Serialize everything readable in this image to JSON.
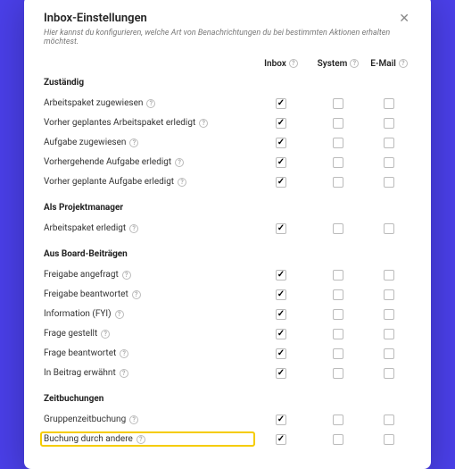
{
  "modal": {
    "title": "Inbox-Einstellungen",
    "description": "Hier kannst du konfigurieren, welche Art von Benachrichtungen du bei bestimmten Aktionen erhalten möchtest."
  },
  "columns": [
    "Inbox",
    "System",
    "E-Mail"
  ],
  "sections": [
    {
      "title": "Zuständig",
      "rows": [
        {
          "label": "Arbeitspaket zugewiesen",
          "checks": [
            true,
            false,
            false
          ]
        },
        {
          "label": "Vorher geplantes Arbeitspaket erledigt",
          "checks": [
            true,
            false,
            false
          ]
        },
        {
          "label": "Aufgabe zugewiesen",
          "checks": [
            true,
            false,
            false
          ]
        },
        {
          "label": "Vorhergehende Aufgabe erledigt",
          "checks": [
            true,
            false,
            false
          ]
        },
        {
          "label": "Vorher geplante Aufgabe erledigt",
          "checks": [
            true,
            false,
            false
          ]
        }
      ]
    },
    {
      "title": "Als Projektmanager",
      "rows": [
        {
          "label": "Arbeitspaket erledigt",
          "checks": [
            true,
            false,
            false
          ]
        }
      ]
    },
    {
      "title": "Aus Board-Beiträgen",
      "rows": [
        {
          "label": "Freigabe angefragt",
          "checks": [
            true,
            false,
            false
          ]
        },
        {
          "label": "Freigabe beantwortet",
          "checks": [
            true,
            false,
            false
          ]
        },
        {
          "label": "Information (FYI)",
          "checks": [
            true,
            false,
            false
          ]
        },
        {
          "label": "Frage gestellt",
          "checks": [
            true,
            false,
            false
          ]
        },
        {
          "label": "Frage beantwortet",
          "checks": [
            true,
            false,
            false
          ]
        },
        {
          "label": "In Beitrag erwähnt",
          "checks": [
            true,
            false,
            false
          ]
        }
      ]
    },
    {
      "title": "Zeitbuchungen",
      "rows": [
        {
          "label": "Gruppenzeitbuchung",
          "checks": [
            true,
            false,
            false
          ]
        },
        {
          "label": "Buchung durch andere",
          "checks": [
            true,
            false,
            false
          ],
          "highlighted": true
        }
      ]
    }
  ]
}
